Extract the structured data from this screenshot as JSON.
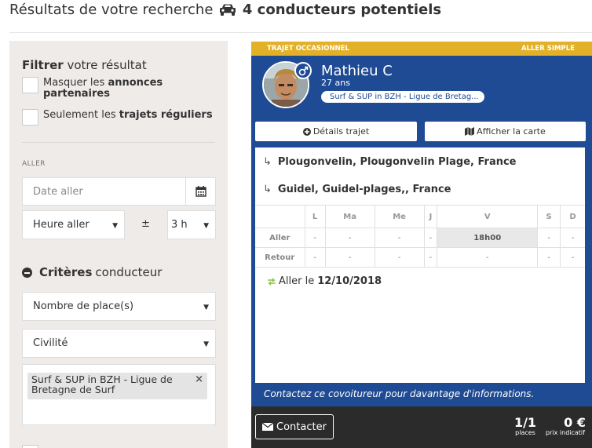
{
  "page": {
    "title_prefix": "Résultats de votre recherche",
    "title_count": "4 conducteurs potentiels",
    "car_icon": "car-icon"
  },
  "filters": {
    "heading_bold": "Filtrer",
    "heading_rest": " votre résultat",
    "checkbox_partner_pre": "Masquer les ",
    "checkbox_partner_bold": "annonces partenaires",
    "checkbox_regular_pre": "Seulement les ",
    "checkbox_regular_bold": "trajets réguliers",
    "section_label": "ALLER",
    "date_placeholder": "Date aller",
    "hour_value": "Heure aller",
    "plus_minus": "±",
    "tolerance_value": "3 h",
    "criteria_bold": "Critères",
    "criteria_rest": "conducteur",
    "seats_value": "Nombre de place(s)",
    "civility_value": "Civilité",
    "tag_value": "Surf & SUP in BZH - Ligue de Bretagne de Surf",
    "tag_remove": "×"
  },
  "card": {
    "badge_left": "TRAJET OCCASIONNEL",
    "badge_right": "ALLER SIMPLE",
    "driver_name": "Mathieu C",
    "driver_age": "27 ans",
    "driver_group": "Surf & SUP in BZH - Ligue de Bretag...",
    "details_button": "Détails trajet",
    "map_button": "Afficher la carte",
    "route_arrow": "↳",
    "route_from": "Plougonvelin, Plougonvelin Plage, France",
    "route_to": "Guidel, Guidel-plages,, France",
    "schedule": {
      "days": [
        "L",
        "Ma",
        "Me",
        "J",
        "V",
        "S",
        "D"
      ],
      "rows": [
        {
          "label": "Aller",
          "cells": [
            "-",
            "-",
            "-",
            "-",
            "18h00",
            "-",
            "-"
          ]
        },
        {
          "label": "Retour",
          "cells": [
            "-",
            "-",
            "-",
            "-",
            "-",
            "-",
            "-"
          ]
        }
      ]
    },
    "aller_label": "Aller le",
    "aller_date": "12/10/2018",
    "contact_hint": "Contactez ce covoitureur pour davantage d'informations.",
    "contact_button": "Contacter",
    "seats_value": "1/1",
    "seats_label": "places",
    "price_value": "0 €",
    "price_label": "prix indicatif"
  },
  "colors": {
    "card_blue": "#1e4b94",
    "badge_yellow": "#e3b128",
    "sidebar_bg": "#efebe9",
    "footer_dark": "#2b2b2b"
  }
}
